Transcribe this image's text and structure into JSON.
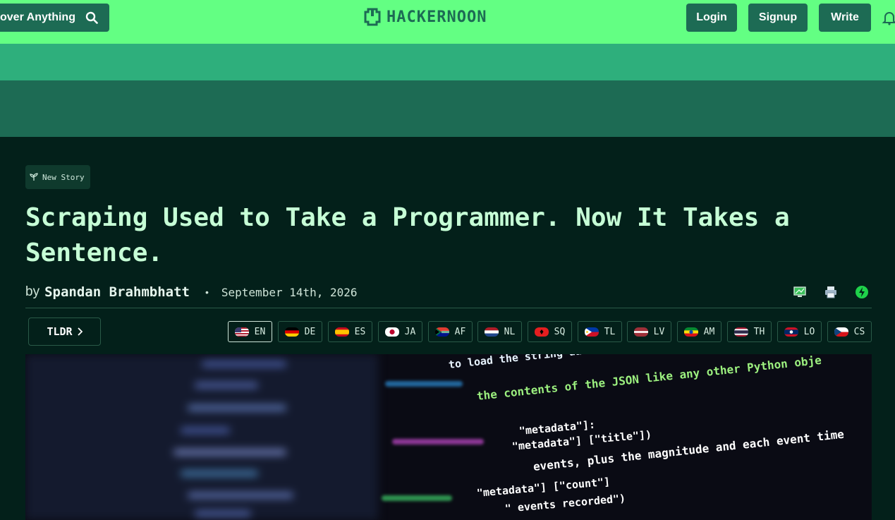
{
  "header": {
    "search_label": "over Anything",
    "logo_text": "HACKERNOON",
    "login": "Login",
    "signup": "Signup",
    "write": "Write"
  },
  "article": {
    "badge": "New Story",
    "title": "Scraping Used to Take a Programmer. Now It Takes a Sentence.",
    "by": "by",
    "author": "Spandan Brahmbhatt",
    "separator": "•",
    "date": "September 14th, 2026",
    "tldr": "TLDR",
    "languages": [
      "EN",
      "DE",
      "ES",
      "JA",
      "AF",
      "NL",
      "SQ",
      "TL",
      "LV",
      "AM",
      "TH",
      "LO",
      "CS"
    ],
    "hero_code": [
      "to load the string data into a",
      "the contents of the JSON like any other Python obje",
      "\"metadata\"]:",
      "\"metadata\"] [\"title\"])",
      "events, plus the magnitude and each event time",
      "\"metadata\"] [\"count\"]",
      "\" events recorded\")"
    ]
  }
}
